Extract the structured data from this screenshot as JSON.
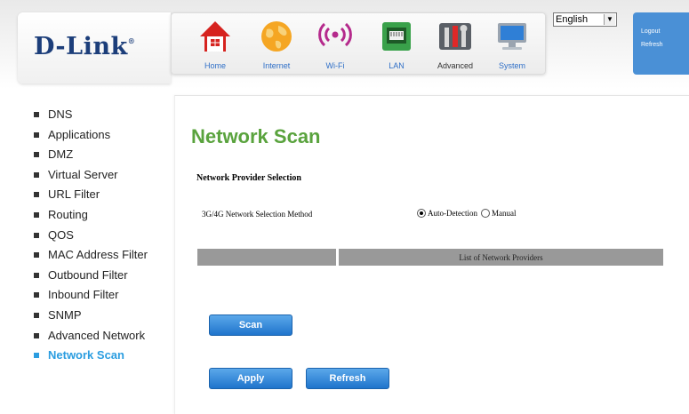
{
  "brand": {
    "logo_text": "D-Link",
    "logo_mark": "®"
  },
  "nav": [
    {
      "label": "Home",
      "icon": "house-icon"
    },
    {
      "label": "Internet",
      "icon": "globe-icon"
    },
    {
      "label": "Wi-Fi",
      "icon": "wifi-signal-icon"
    },
    {
      "label": "LAN",
      "icon": "ethernet-port-icon"
    },
    {
      "label": "Advanced",
      "icon": "tools-icon"
    },
    {
      "label": "System",
      "icon": "computer-monitor-icon"
    }
  ],
  "language": {
    "selected": "English"
  },
  "top_links": {
    "logout": "Logout",
    "refresh": "Refresh"
  },
  "sidebar": {
    "items": [
      {
        "label": "DNS"
      },
      {
        "label": "Applications"
      },
      {
        "label": "DMZ"
      },
      {
        "label": "Virtual Server"
      },
      {
        "label": "URL Filter"
      },
      {
        "label": "Routing"
      },
      {
        "label": "QOS"
      },
      {
        "label": "MAC Address Filter"
      },
      {
        "label": "Outbound Filter"
      },
      {
        "label": "Inbound Filter"
      },
      {
        "label": "SNMP"
      },
      {
        "label": "Advanced Network"
      },
      {
        "label": "Network Scan",
        "active": true
      }
    ]
  },
  "main": {
    "title": "Network Scan",
    "section_title": "Network Provider Selection",
    "method_label": "3G/4G Network Selection Method",
    "radio_options": [
      {
        "label": "Auto-Detection",
        "checked": true
      },
      {
        "label": "Manual",
        "checked": false
      }
    ],
    "table_headers": [
      "",
      "List of Network Providers"
    ],
    "buttons": {
      "scan": "Scan",
      "apply": "Apply",
      "refresh": "Refresh"
    }
  },
  "colors": {
    "brand_blue": "#1c3e7a",
    "title_green": "#5aa33e",
    "active_blue": "#2b9de0",
    "button_blue": "#2f80d4"
  }
}
